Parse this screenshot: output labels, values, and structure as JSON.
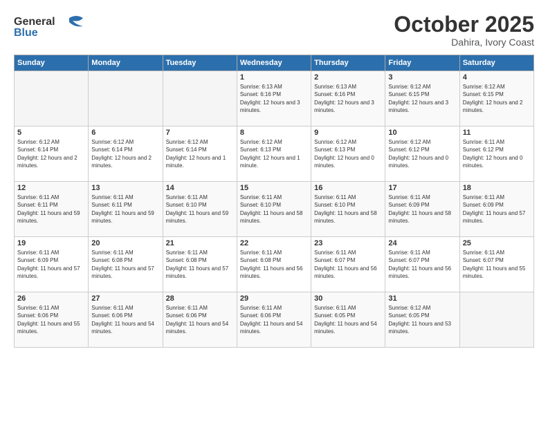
{
  "header": {
    "logo_line1": "General",
    "logo_line2": "Blue",
    "title": "October 2025",
    "subtitle": "Dahira, Ivory Coast"
  },
  "weekdays": [
    "Sunday",
    "Monday",
    "Tuesday",
    "Wednesday",
    "Thursday",
    "Friday",
    "Saturday"
  ],
  "weeks": [
    [
      {
        "day": "",
        "sunrise": "",
        "sunset": "",
        "daylight": ""
      },
      {
        "day": "",
        "sunrise": "",
        "sunset": "",
        "daylight": ""
      },
      {
        "day": "",
        "sunrise": "",
        "sunset": "",
        "daylight": ""
      },
      {
        "day": "1",
        "sunrise": "Sunrise: 6:13 AM",
        "sunset": "Sunset: 6:16 PM",
        "daylight": "Daylight: 12 hours and 3 minutes."
      },
      {
        "day": "2",
        "sunrise": "Sunrise: 6:13 AM",
        "sunset": "Sunset: 6:16 PM",
        "daylight": "Daylight: 12 hours and 3 minutes."
      },
      {
        "day": "3",
        "sunrise": "Sunrise: 6:12 AM",
        "sunset": "Sunset: 6:15 PM",
        "daylight": "Daylight: 12 hours and 3 minutes."
      },
      {
        "day": "4",
        "sunrise": "Sunrise: 6:12 AM",
        "sunset": "Sunset: 6:15 PM",
        "daylight": "Daylight: 12 hours and 2 minutes."
      }
    ],
    [
      {
        "day": "5",
        "sunrise": "Sunrise: 6:12 AM",
        "sunset": "Sunset: 6:14 PM",
        "daylight": "Daylight: 12 hours and 2 minutes."
      },
      {
        "day": "6",
        "sunrise": "Sunrise: 6:12 AM",
        "sunset": "Sunset: 6:14 PM",
        "daylight": "Daylight: 12 hours and 2 minutes."
      },
      {
        "day": "7",
        "sunrise": "Sunrise: 6:12 AM",
        "sunset": "Sunset: 6:14 PM",
        "daylight": "Daylight: 12 hours and 1 minute."
      },
      {
        "day": "8",
        "sunrise": "Sunrise: 6:12 AM",
        "sunset": "Sunset: 6:13 PM",
        "daylight": "Daylight: 12 hours and 1 minute."
      },
      {
        "day": "9",
        "sunrise": "Sunrise: 6:12 AM",
        "sunset": "Sunset: 6:13 PM",
        "daylight": "Daylight: 12 hours and 0 minutes."
      },
      {
        "day": "10",
        "sunrise": "Sunrise: 6:12 AM",
        "sunset": "Sunset: 6:12 PM",
        "daylight": "Daylight: 12 hours and 0 minutes."
      },
      {
        "day": "11",
        "sunrise": "Sunrise: 6:11 AM",
        "sunset": "Sunset: 6:12 PM",
        "daylight": "Daylight: 12 hours and 0 minutes."
      }
    ],
    [
      {
        "day": "12",
        "sunrise": "Sunrise: 6:11 AM",
        "sunset": "Sunset: 6:11 PM",
        "daylight": "Daylight: 11 hours and 59 minutes."
      },
      {
        "day": "13",
        "sunrise": "Sunrise: 6:11 AM",
        "sunset": "Sunset: 6:11 PM",
        "daylight": "Daylight: 11 hours and 59 minutes."
      },
      {
        "day": "14",
        "sunrise": "Sunrise: 6:11 AM",
        "sunset": "Sunset: 6:10 PM",
        "daylight": "Daylight: 11 hours and 59 minutes."
      },
      {
        "day": "15",
        "sunrise": "Sunrise: 6:11 AM",
        "sunset": "Sunset: 6:10 PM",
        "daylight": "Daylight: 11 hours and 58 minutes."
      },
      {
        "day": "16",
        "sunrise": "Sunrise: 6:11 AM",
        "sunset": "Sunset: 6:10 PM",
        "daylight": "Daylight: 11 hours and 58 minutes."
      },
      {
        "day": "17",
        "sunrise": "Sunrise: 6:11 AM",
        "sunset": "Sunset: 6:09 PM",
        "daylight": "Daylight: 11 hours and 58 minutes."
      },
      {
        "day": "18",
        "sunrise": "Sunrise: 6:11 AM",
        "sunset": "Sunset: 6:09 PM",
        "daylight": "Daylight: 11 hours and 57 minutes."
      }
    ],
    [
      {
        "day": "19",
        "sunrise": "Sunrise: 6:11 AM",
        "sunset": "Sunset: 6:09 PM",
        "daylight": "Daylight: 11 hours and 57 minutes."
      },
      {
        "day": "20",
        "sunrise": "Sunrise: 6:11 AM",
        "sunset": "Sunset: 6:08 PM",
        "daylight": "Daylight: 11 hours and 57 minutes."
      },
      {
        "day": "21",
        "sunrise": "Sunrise: 6:11 AM",
        "sunset": "Sunset: 6:08 PM",
        "daylight": "Daylight: 11 hours and 57 minutes."
      },
      {
        "day": "22",
        "sunrise": "Sunrise: 6:11 AM",
        "sunset": "Sunset: 6:08 PM",
        "daylight": "Daylight: 11 hours and 56 minutes."
      },
      {
        "day": "23",
        "sunrise": "Sunrise: 6:11 AM",
        "sunset": "Sunset: 6:07 PM",
        "daylight": "Daylight: 11 hours and 56 minutes."
      },
      {
        "day": "24",
        "sunrise": "Sunrise: 6:11 AM",
        "sunset": "Sunset: 6:07 PM",
        "daylight": "Daylight: 11 hours and 56 minutes."
      },
      {
        "day": "25",
        "sunrise": "Sunrise: 6:11 AM",
        "sunset": "Sunset: 6:07 PM",
        "daylight": "Daylight: 11 hours and 55 minutes."
      }
    ],
    [
      {
        "day": "26",
        "sunrise": "Sunrise: 6:11 AM",
        "sunset": "Sunset: 6:06 PM",
        "daylight": "Daylight: 11 hours and 55 minutes."
      },
      {
        "day": "27",
        "sunrise": "Sunrise: 6:11 AM",
        "sunset": "Sunset: 6:06 PM",
        "daylight": "Daylight: 11 hours and 54 minutes."
      },
      {
        "day": "28",
        "sunrise": "Sunrise: 6:11 AM",
        "sunset": "Sunset: 6:06 PM",
        "daylight": "Daylight: 11 hours and 54 minutes."
      },
      {
        "day": "29",
        "sunrise": "Sunrise: 6:11 AM",
        "sunset": "Sunset: 6:06 PM",
        "daylight": "Daylight: 11 hours and 54 minutes."
      },
      {
        "day": "30",
        "sunrise": "Sunrise: 6:11 AM",
        "sunset": "Sunset: 6:05 PM",
        "daylight": "Daylight: 11 hours and 54 minutes."
      },
      {
        "day": "31",
        "sunrise": "Sunrise: 6:12 AM",
        "sunset": "Sunset: 6:05 PM",
        "daylight": "Daylight: 11 hours and 53 minutes."
      },
      {
        "day": "",
        "sunrise": "",
        "sunset": "",
        "daylight": ""
      }
    ]
  ]
}
